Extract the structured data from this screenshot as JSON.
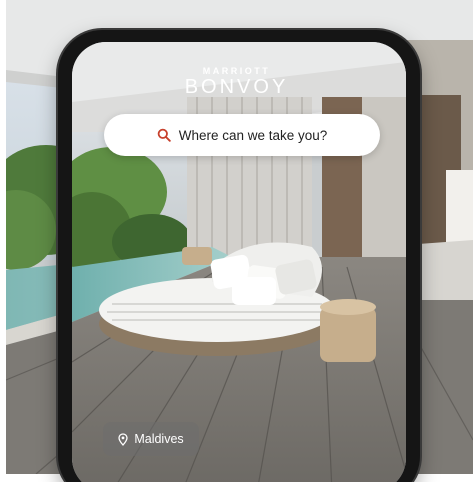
{
  "brand": {
    "top": "MARRIOTT",
    "main": "BONVOY"
  },
  "search": {
    "placeholder": "Where can we take you?"
  },
  "location": {
    "label": "Maldives"
  },
  "icons": {
    "search": "search-icon",
    "location": "map-pin-icon"
  },
  "colors": {
    "accent": "#c7402c",
    "pill_bg": "#6e6e6e"
  }
}
